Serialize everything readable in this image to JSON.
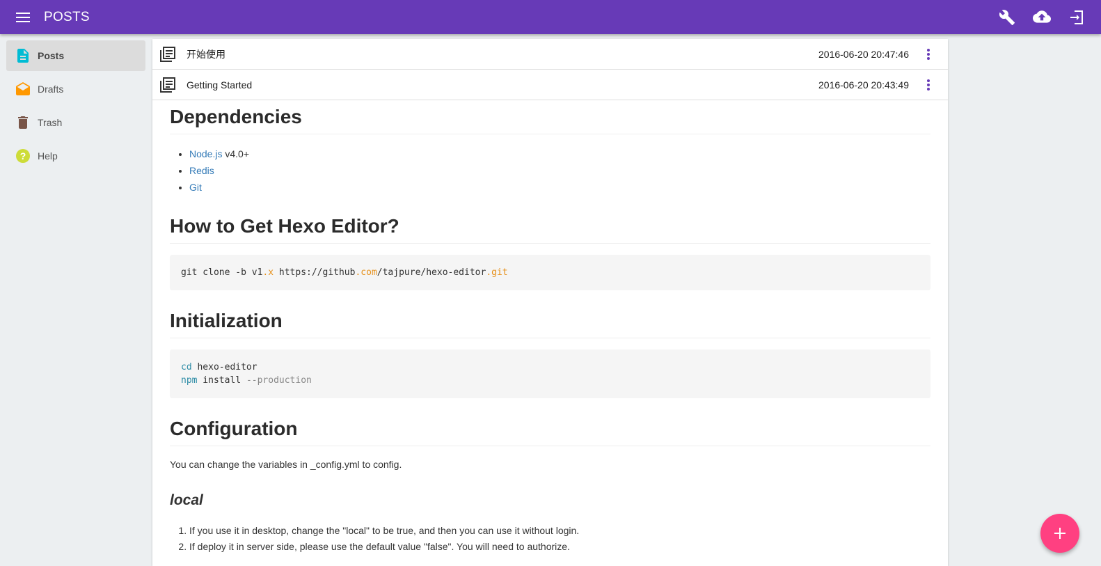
{
  "appbar": {
    "title": "POSTS",
    "icons": [
      "menu-icon",
      "wrench-icon",
      "cloud-upload-icon",
      "exit-icon"
    ]
  },
  "sidebar": {
    "items": [
      {
        "label": "Posts",
        "icon": "post-icon",
        "color": "#00bcd4",
        "active": true
      },
      {
        "label": "Drafts",
        "icon": "drafts-icon",
        "color": "#ff9800"
      },
      {
        "label": "Trash",
        "icon": "trash-icon",
        "color": "#795548"
      },
      {
        "label": "Help",
        "icon": "help-icon",
        "color": "#cddc39"
      }
    ]
  },
  "posts": [
    {
      "title": "开始使用",
      "date": "2016-06-20 20:47:46"
    },
    {
      "title": "Getting Started",
      "date": "2016-06-20 20:43:49"
    }
  ],
  "article": {
    "dependencies": {
      "heading": "Dependencies",
      "items": [
        {
          "link": "Node.js",
          "rest": " v4.0+"
        },
        {
          "link": "Redis",
          "rest": ""
        },
        {
          "link": "Git",
          "rest": ""
        }
      ]
    },
    "get": {
      "heading": "How to Get Hexo Editor?",
      "code": {
        "p1": "git clone -b v1",
        "p2": ".x",
        "p3": " https://github",
        "p4": ".com",
        "p5": "/tajpure/hexo-editor",
        "p6": ".git"
      }
    },
    "init": {
      "heading": "Initialization",
      "line1": {
        "cmd": "cd",
        "arg": " hexo-editor"
      },
      "line2": {
        "cmd": "npm",
        "arg": " install ",
        "flag": "--production"
      }
    },
    "config": {
      "heading": "Configuration",
      "text": "You can change the variables in _config.yml to config.",
      "sub": "local",
      "list": [
        "If you use it in desktop, change the \"local\" to be true, and then you can use it without login.",
        "If deploy it in server side, please use the default value \"false\". You will need to authorize."
      ]
    }
  },
  "colors": {
    "primary": "#673ab7",
    "accent": "#ff4081",
    "link": "#337ab7"
  },
  "fab": {
    "icon": "plus-icon"
  }
}
